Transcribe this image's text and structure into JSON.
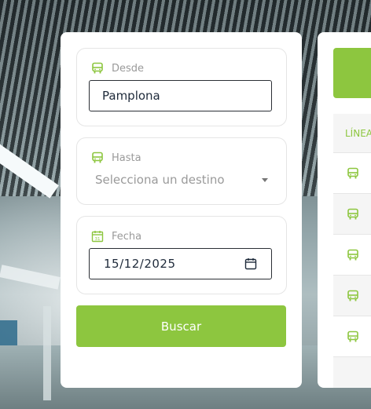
{
  "form": {
    "from": {
      "label": "Desde",
      "value": "Pamplona"
    },
    "to": {
      "label": "Hasta",
      "placeholder": "Selecciona un destino"
    },
    "date": {
      "label": "Fecha",
      "day": "15",
      "month": "12",
      "year": "2025"
    },
    "search_label": "Buscar"
  },
  "results": {
    "column_header": "LÍNEA"
  },
  "colors": {
    "accent": "#8dc63f",
    "field_border": "#2b2f35",
    "muted_text": "#9a9a9a"
  },
  "icons": {
    "from": "bus-icon",
    "to": "bus-icon",
    "date": "calendar-icon",
    "date_picker": "calendar-picker-icon",
    "dropdown": "chevron-down-icon",
    "row": "bus-icon"
  }
}
